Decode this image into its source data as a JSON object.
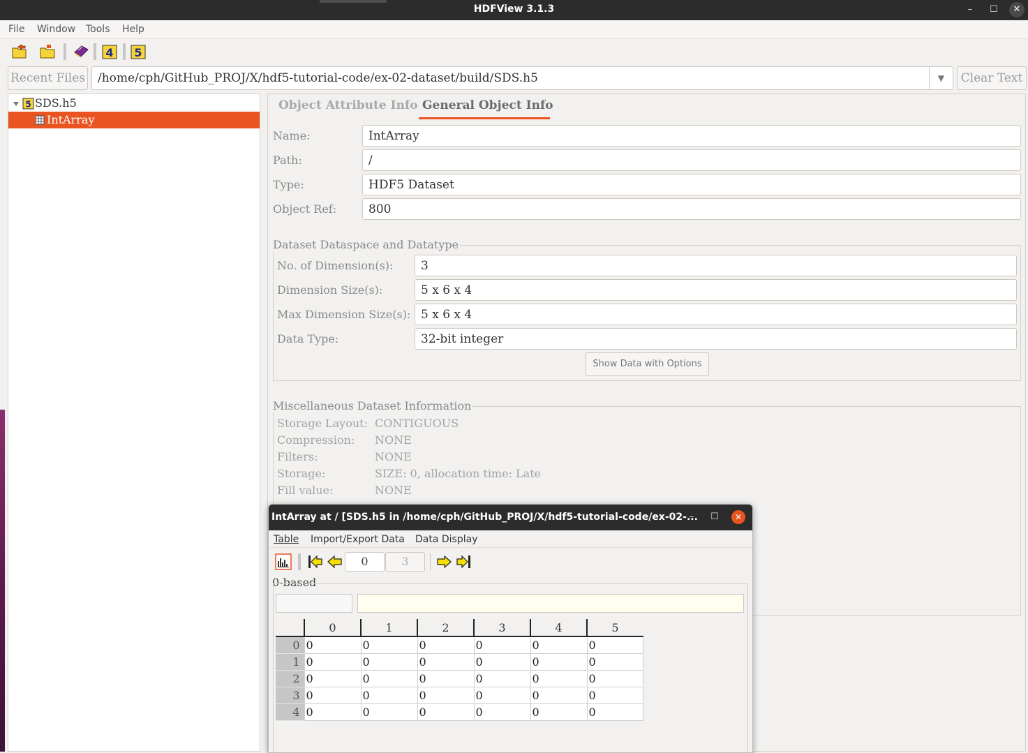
{
  "window": {
    "title": "HDFView 3.1.3"
  },
  "menu": [
    "File",
    "Window",
    "Tools",
    "Help"
  ],
  "toolbar": {
    "icons": [
      "open-file-icon",
      "open-folder-icon",
      "help-book-icon",
      "hdf4-icon",
      "hdf5-icon"
    ]
  },
  "recent_files_label": "Recent Files",
  "path": "/home/cph/GitHub_PROJ/X/hdf5-tutorial-code/ex-02-dataset/build/SDS.h5",
  "clear_text_label": "Clear Text",
  "tree": {
    "root": "SDS.h5",
    "child": "IntArray"
  },
  "tabs": {
    "attribute": "Object Attribute Info",
    "general": "General Object Info"
  },
  "general": {
    "name_label": "Name:",
    "name": "IntArray",
    "path_label": "Path:",
    "path": "/",
    "type_label": "Type:",
    "type": "HDF5 Dataset",
    "ref_label": "Object Ref:",
    "ref": "800"
  },
  "dataspace": {
    "title": "Dataset Dataspace and Datatype",
    "ndims_label": "No. of Dimension(s):",
    "ndims": "3",
    "dims_label": "Dimension Size(s):",
    "dims": "5 x 6 x 4",
    "maxdims_label": "Max Dimension Size(s):",
    "maxdims": "5 x 6 x 4",
    "dtype_label": "Data Type:",
    "dtype": "32-bit integer",
    "show_button": "Show Data with Options"
  },
  "misc": {
    "title": "Miscellaneous Dataset Information",
    "rows": [
      {
        "label": "Storage Layout:",
        "value": "CONTIGUOUS"
      },
      {
        "label": "Compression:",
        "value": "NONE"
      },
      {
        "label": "Filters:",
        "value": "NONE"
      },
      {
        "label": "Storage:",
        "value": "SIZE: 0, allocation time: Late"
      },
      {
        "label": "Fill value:",
        "value": "NONE"
      }
    ]
  },
  "dialog": {
    "title": "IntArray  at  /  [SDS.h5  in  /home/cph/GitHub_PROJ/X/hdf5-tutorial-code/ex-02-...",
    "menu": [
      "Table",
      "Import/Export Data",
      "Data Display"
    ],
    "page_current": "0",
    "page_max": "3",
    "index_base": "0-based",
    "columns": [
      "0",
      "1",
      "2",
      "3",
      "4",
      "5"
    ],
    "rows": [
      {
        "h": "0",
        "c": [
          "0",
          "0",
          "0",
          "0",
          "0",
          "0"
        ]
      },
      {
        "h": "1",
        "c": [
          "0",
          "0",
          "0",
          "0",
          "0",
          "0"
        ]
      },
      {
        "h": "2",
        "c": [
          "0",
          "0",
          "0",
          "0",
          "0",
          "0"
        ]
      },
      {
        "h": "3",
        "c": [
          "0",
          "0",
          "0",
          "0",
          "0",
          "0"
        ]
      },
      {
        "h": "4",
        "c": [
          "0",
          "0",
          "0",
          "0",
          "0",
          "0"
        ]
      }
    ]
  }
}
